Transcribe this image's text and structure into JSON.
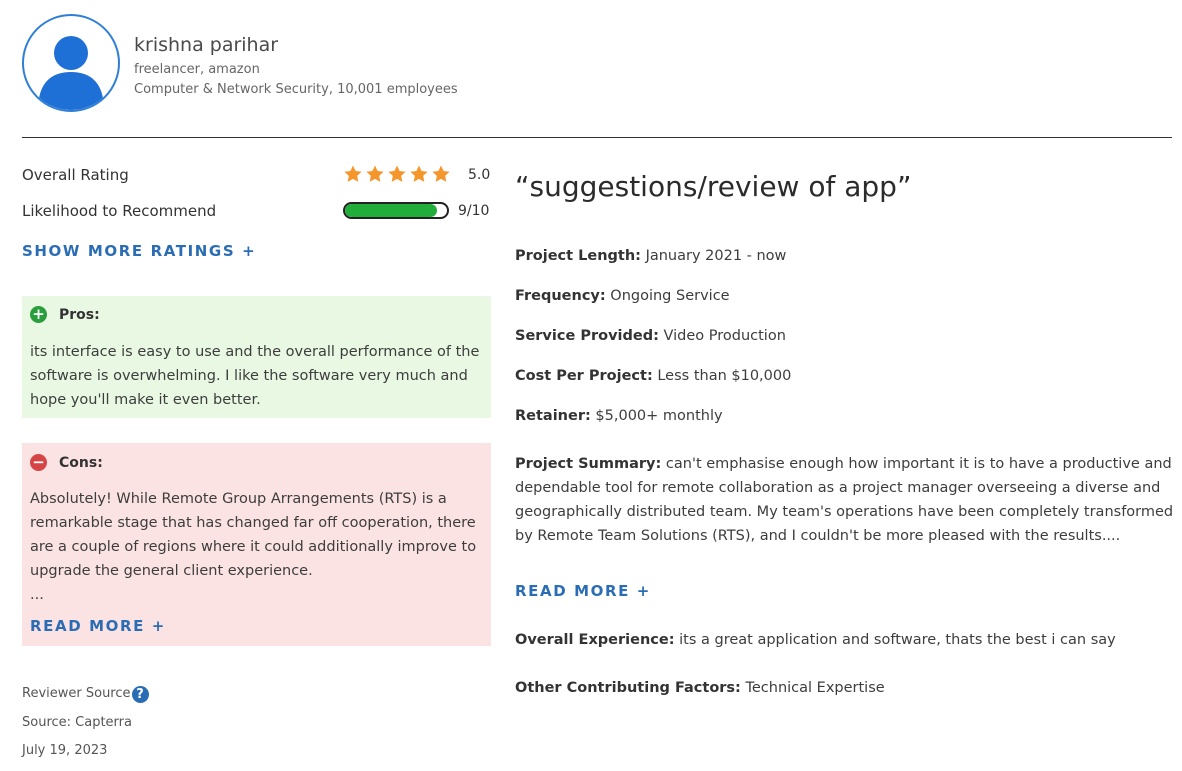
{
  "reviewer": {
    "name": "krishna parihar",
    "role": "freelancer, amazon",
    "company": "Computer & Network Security, 10,001 employees"
  },
  "ratings": {
    "overall_label": "Overall Rating",
    "overall_score": "5.0",
    "overall_stars": 5,
    "recommend_label": "Likelihood to Recommend",
    "recommend_score": "9/10",
    "recommend_fraction": 0.9,
    "show_more": "SHOW MORE RATINGS +"
  },
  "pros": {
    "label": "Pros:",
    "text": "its interface is easy to use and the overall performance of the software is overwhelming. I like the software very much and hope you'll make it even better."
  },
  "cons": {
    "label": "Cons:",
    "text": "Absolutely! While Remote Group Arrangements (RTS) is a remarkable stage that has changed far off cooperation, there are a couple of regions where it could additionally improve to upgrade the general client experience.",
    "ellipsis": "...",
    "read_more": "READ MORE +"
  },
  "source": {
    "reviewer_source_label": "Reviewer Source",
    "help_icon": "?",
    "source_text": "Source: Capterra",
    "date": "July 19, 2023"
  },
  "review": {
    "title": "“suggestions/review of app”",
    "project_length_label": "Project Length:",
    "project_length": "January 2021 - now",
    "frequency_label": "Frequency:",
    "frequency": "Ongoing Service",
    "service_label": "Service Provided:",
    "service": "Video Production",
    "cost_label": "Cost Per Project:",
    "cost": "Less than $10,000",
    "retainer_label": "Retainer:",
    "retainer": "$5,000+ monthly",
    "summary_label": "Project Summary:",
    "summary": "can't emphasise enough how important it is to have a productive and dependable tool for remote collaboration as a project manager overseeing a diverse and geographically distributed team. My team's operations have been completely transformed by Remote Team Solutions (RTS), and I couldn't be more pleased with the results....",
    "read_more": "READ MORE +",
    "experience_label": "Overall Experience:",
    "experience": "its a great application and software, thats the best i can say",
    "factors_label": "Other Contributing Factors:",
    "factors": "Technical Expertise"
  },
  "colors": {
    "accent_blue": "#2a6db5",
    "star_orange": "#f5962d",
    "bar_green": "#21ad3a",
    "pros_bg": "#e9f8e3",
    "cons_bg": "#fbe3e3"
  },
  "icons": [
    "user-avatar-icon",
    "star-icon",
    "plus-circle-icon",
    "minus-circle-icon",
    "help-icon"
  ]
}
